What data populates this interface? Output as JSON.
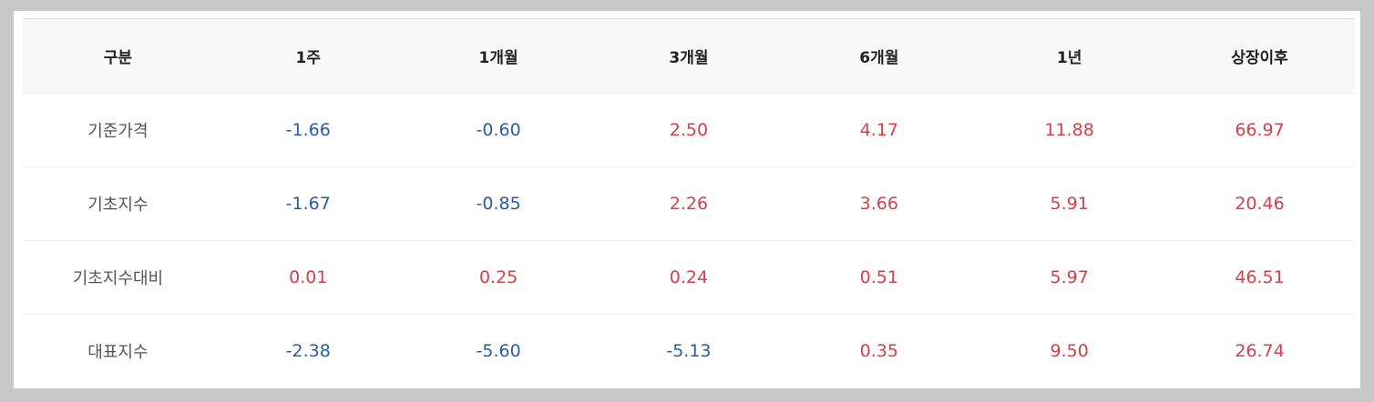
{
  "table": {
    "headers": [
      "구분",
      "1주",
      "1개월",
      "3개월",
      "6개월",
      "1년",
      "상장이후"
    ],
    "rows": [
      {
        "label": "기준가격",
        "values": [
          "-1.66",
          "-0.60",
          "2.50",
          "4.17",
          "11.88",
          "66.97"
        ]
      },
      {
        "label": "기초지수",
        "values": [
          "-1.67",
          "-0.85",
          "2.26",
          "3.66",
          "5.91",
          "20.46"
        ]
      },
      {
        "label": "기초지수대비",
        "values": [
          "0.01",
          "0.25",
          "0.24",
          "0.51",
          "5.97",
          "46.51"
        ]
      },
      {
        "label": "대표지수",
        "values": [
          "-2.38",
          "-5.60",
          "-5.13",
          "0.35",
          "9.50",
          "26.74"
        ]
      }
    ]
  },
  "colors": {
    "negative": "#2b5ba8",
    "positive": "#d2424b",
    "header_bg": "#f8f8f8",
    "page_bg": "#c8c8c8"
  }
}
